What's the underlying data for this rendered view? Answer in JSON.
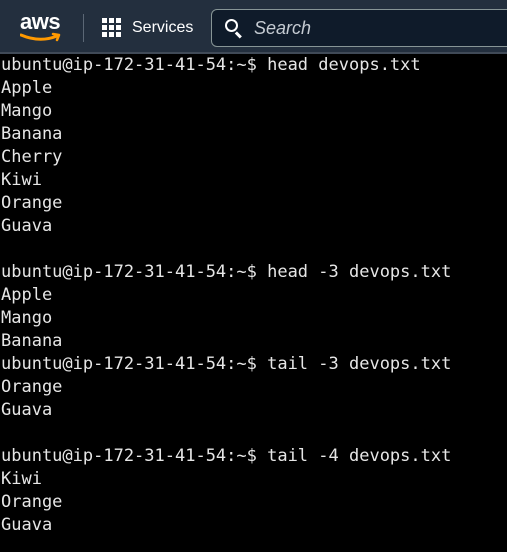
{
  "header": {
    "logo_text": "aws",
    "services_label": "Services",
    "search_placeholder": "Search",
    "colors": {
      "bar": "#232f3e",
      "smile": "#ff9900"
    }
  },
  "terminal": {
    "lines": [
      "ubuntu@ip-172-31-41-54:~$ head devops.txt",
      "Apple",
      "Mango",
      "Banana",
      "Cherry",
      "Kiwi",
      "Orange",
      "Guava",
      "",
      "ubuntu@ip-172-31-41-54:~$ head -3 devops.txt",
      "Apple",
      "Mango",
      "Banana",
      "ubuntu@ip-172-31-41-54:~$ tail -3 devops.txt",
      "Orange",
      "Guava",
      "",
      "ubuntu@ip-172-31-41-54:~$ tail -4 devops.txt",
      "Kiwi",
      "Orange",
      "Guava"
    ]
  }
}
